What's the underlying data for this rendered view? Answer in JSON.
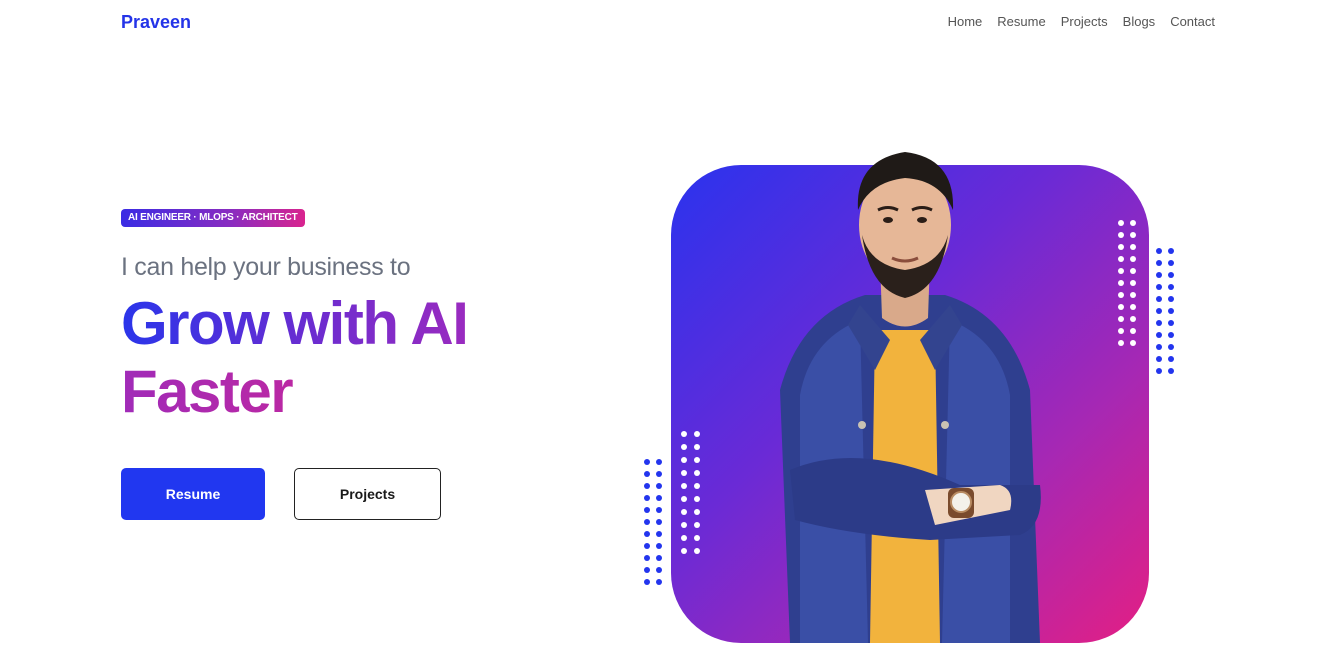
{
  "nav": {
    "brand": "Praveen",
    "items": [
      {
        "label": "Home"
      },
      {
        "label": "Resume"
      },
      {
        "label": "Projects"
      },
      {
        "label": "Blogs"
      },
      {
        "label": "Contact"
      }
    ]
  },
  "hero": {
    "badge": "AI ENGINEER · MLOPS · ARCHITECT",
    "tagline": "I can help your business to",
    "headline_line1": "Grow with AI",
    "headline_line2": "Faster",
    "primary_button": "Resume",
    "secondary_button": "Projects"
  },
  "colors": {
    "brand": "#2434e8",
    "primary_button": "#2137f0",
    "gradient_start": "#2a33ee",
    "gradient_end": "#e41f83"
  }
}
